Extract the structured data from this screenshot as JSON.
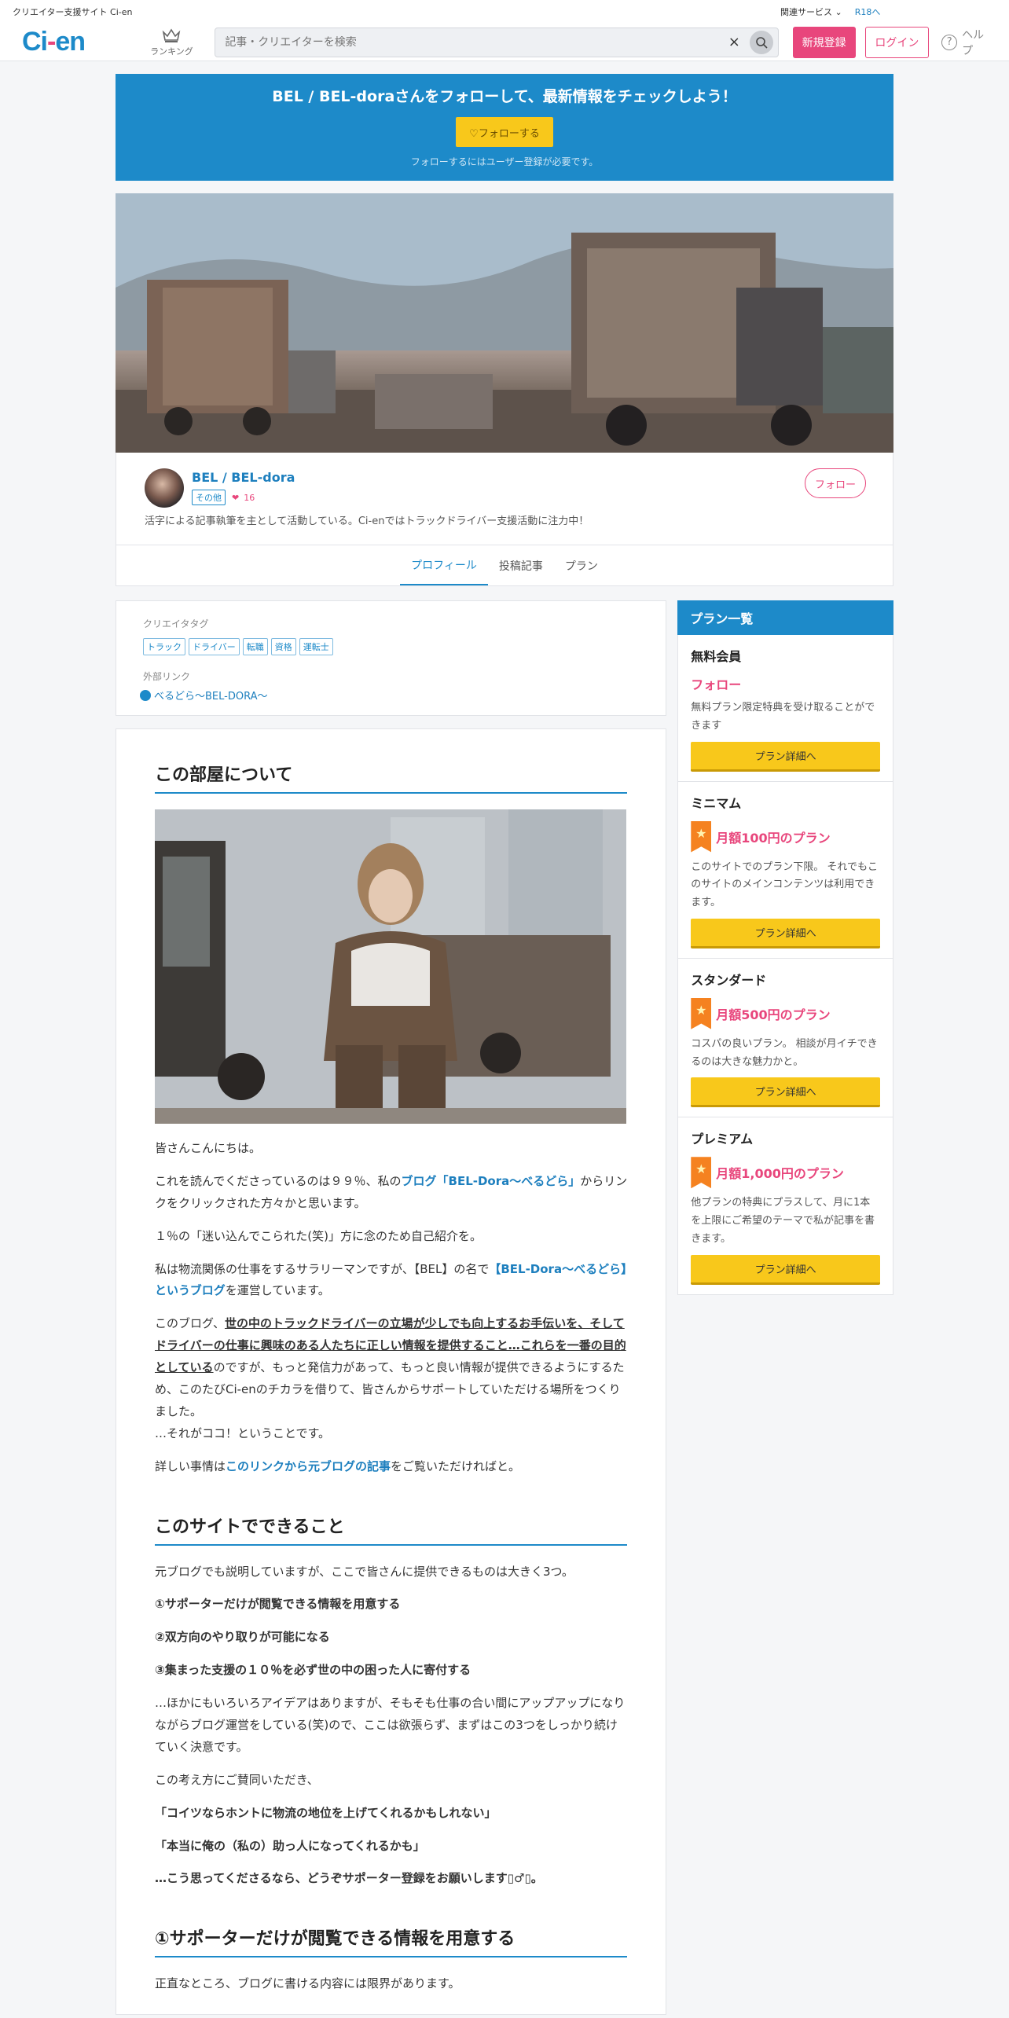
{
  "topbar": {
    "site_name": "クリエイター支援サイト Ci-en",
    "related": "関連サービス",
    "r18": "R18へ"
  },
  "header": {
    "logo_main": "Ci",
    "logo_dash": "-",
    "logo_end": "en",
    "ranking": "ランキング",
    "search_placeholder": "記事・クリエイターを検索",
    "register": "新規登録",
    "login": "ログイン",
    "help": "ヘルプ"
  },
  "banner": {
    "title": "BEL / BEL-doraさんをフォローして、最新情報をチェックしよう！",
    "follow_button": "♡フォローする",
    "note": "フォローするにはユーザー登録が必要です。"
  },
  "profile": {
    "name": "BEL / BEL-dora",
    "category": "その他",
    "fans": "16",
    "follow": "フォロー",
    "description": "活字による記事執筆を主として活動している。Ci-enではトラックドライバー支援活動に注力中！"
  },
  "tabs": [
    {
      "label": "プロフィール",
      "active": true
    },
    {
      "label": "投稿記事",
      "active": false
    },
    {
      "label": "プラン",
      "active": false
    }
  ],
  "creator_tags": {
    "label": "クリエイタタグ",
    "tags": [
      "トラック",
      "ドライバー",
      "転職",
      "資格",
      "運転士"
    ],
    "external_label": "外部リンク",
    "external_link": "べるどら～BEL-DORA～"
  },
  "article": {
    "h1": "この部屋について",
    "p1": "皆さんこんにちは。",
    "p2a": "これを読んでくださっているのは９９％、私の",
    "p2link": "ブログ「BEL-Dora～べるどら」",
    "p2b": "からリンクをクリックされた方々かと思います。",
    "p3": "１％の「迷い込んでこられた(笑)」方に念のため自己紹介を。",
    "p4a": "私は物流関係の仕事をするサラリーマンですが、【BEL】の名で",
    "p4link": "【BEL-Dora～べるどら】というブログ",
    "p4b": "を運営しています。",
    "p5a": "このブログ、",
    "p5u": "世の中のトラックドライバーの立場が少しでも向上するお手伝いを、そしてドライバーの仕事に興味のある人たちに正しい情報を提供すること…これらを一番の目的としている",
    "p5b": "のですが、もっと発信力があって、もっと良い情報が提供できるようにするため、このたびCi-enのチカラを借りて、皆さんからサポートしていただける場所をつくりました。",
    "p5c": "…それがココ！ということです。",
    "p6a": "詳しい事情は",
    "p6link": "このリンクから元ブログの記事",
    "p6b": "をご覧いただければと。",
    "h2": "このサイトでできること",
    "q1": "元ブログでも説明していますが、ここで皆さんに提供できるものは大きく3つ。",
    "q2": "①サポーターだけが閲覧できる情報を用意する",
    "q3": "②双方向のやり取りが可能になる",
    "q4": "③集まった支援の１０％を必ず世の中の困った人に寄付する",
    "q5": "…ほかにもいろいろアイデアはありますが、そもそも仕事の合い間にアップアップになりながらブログ運営をしている(笑)ので、ここは欲張らず、まずはこの3つをしっかり続けていく決意です。",
    "q6": "この考え方にご賛同いただき、",
    "q7": "「コイツならホントに物流の地位を上げてくれるかもしれない」",
    "q8": "「本当に俺の（私の）助っ人になってくれるかも」",
    "q9": "…こう思ってくださるなら、どうぞサポーター登録をお願いします▯♂▯。",
    "h3": "①サポーターだけが閲覧できる情報を用意する",
    "r1": "正直なところ、ブログに書ける内容には限界があります。"
  },
  "plans": {
    "heading": "プラン一覧",
    "items": [
      {
        "name": "無料会員",
        "price": "フォロー",
        "desc": "無料プラン限定特典を受け取ることができます",
        "button": "プラン詳細へ"
      },
      {
        "name": "ミニマム",
        "price": "月額100円のプラン",
        "desc": "このサイトでのプラン下限。 それでもこのサイトのメインコンテンツは利用できます。",
        "button": "プラン詳細へ"
      },
      {
        "name": "スタンダード",
        "price": "月額500円のプラン",
        "desc": "コスパの良いプラン。 相談が月イチできるのは大きな魅力かと。",
        "button": "プラン詳細へ"
      },
      {
        "name": "プレミアム",
        "price": "月額1,000円のプラン",
        "desc": "他プランの特典にプラスして、月に1本を上限にご希望のテーマで私が記事を書きます。",
        "button": "プラン詳細へ"
      }
    ]
  },
  "colors": {
    "brand_blue": "#1d8ac9",
    "brand_pink": "#e8467c",
    "button_yellow": "#f8c81b"
  }
}
